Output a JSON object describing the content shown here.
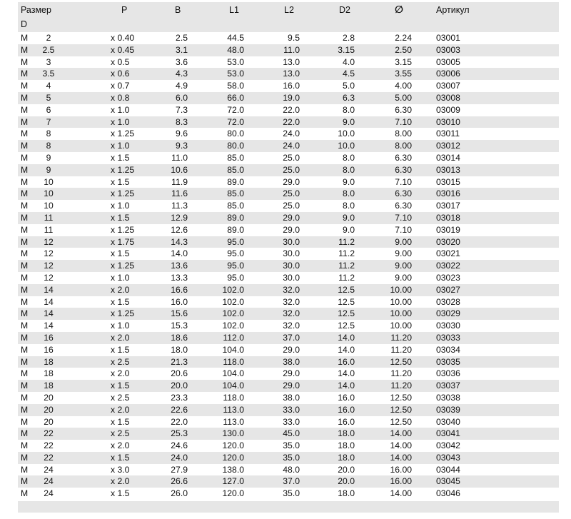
{
  "header": {
    "size": "Размер",
    "d": "D",
    "p": "P",
    "b": "B",
    "l1": "L1",
    "l2": "L2",
    "d2": "D2",
    "dia": "∅",
    "article": "Артикул"
  },
  "rows": [
    {
      "m": "M",
      "d": "2",
      "p": "x 0.40",
      "b": "2.5",
      "l1": "44.5",
      "l2": "9.5",
      "d2": "2.8",
      "dia": "2.24",
      "art": "03001"
    },
    {
      "m": "M",
      "d": "2.5",
      "p": "x 0.45",
      "b": "3.1",
      "l1": "48.0",
      "l2": "11.0",
      "d2": "3.15",
      "dia": "2.50",
      "art": "03003"
    },
    {
      "m": "M",
      "d": "3",
      "p": "x 0.5",
      "b": "3.6",
      "l1": "53.0",
      "l2": "13.0",
      "d2": "4.0",
      "dia": "3.15",
      "art": "03005"
    },
    {
      "m": "M",
      "d": "3.5",
      "p": "x 0.6",
      "b": "4.3",
      "l1": "53.0",
      "l2": "13.0",
      "d2": "4.5",
      "dia": "3.55",
      "art": "03006"
    },
    {
      "m": "M",
      "d": "4",
      "p": "x 0.7",
      "b": "4.9",
      "l1": "58.0",
      "l2": "16.0",
      "d2": "5.0",
      "dia": "4.00",
      "art": "03007"
    },
    {
      "m": "M",
      "d": "5",
      "p": "x 0.8",
      "b": "6.0",
      "l1": "66.0",
      "l2": "19.0",
      "d2": "6.3",
      "dia": "5.00",
      "art": "03008"
    },
    {
      "m": "M",
      "d": "6",
      "p": "x 1.0",
      "b": "7.3",
      "l1": "72.0",
      "l2": "22.0",
      "d2": "8.0",
      "dia": "6.30",
      "art": "03009"
    },
    {
      "m": "M",
      "d": "7",
      "p": "x 1.0",
      "b": "8.3",
      "l1": "72.0",
      "l2": "22.0",
      "d2": "9.0",
      "dia": "7.10",
      "art": "03010"
    },
    {
      "m": "M",
      "d": "8",
      "p": "x 1.25",
      "b": "9.6",
      "l1": "80.0",
      "l2": "24.0",
      "d2": "10.0",
      "dia": "8.00",
      "art": "03011"
    },
    {
      "m": "M",
      "d": "8",
      "p": "x 1.0",
      "b": "9.3",
      "l1": "80.0",
      "l2": "24.0",
      "d2": "10.0",
      "dia": "8.00",
      "art": "03012"
    },
    {
      "m": "M",
      "d": "9",
      "p": "x 1.5",
      "b": "11.0",
      "l1": "85.0",
      "l2": "25.0",
      "d2": "8.0",
      "dia": "6.30",
      "art": "03014"
    },
    {
      "m": "M",
      "d": "9",
      "p": "x 1.25",
      "b": "10.6",
      "l1": "85.0",
      "l2": "25.0",
      "d2": "8.0",
      "dia": "6.30",
      "art": "03013"
    },
    {
      "m": "M",
      "d": "10",
      "p": "x 1.5",
      "b": "11.9",
      "l1": "89.0",
      "l2": "29.0",
      "d2": "9.0",
      "dia": "7.10",
      "art": "03015"
    },
    {
      "m": "M",
      "d": "10",
      "p": "x 1.25",
      "b": "11.6",
      "l1": "85.0",
      "l2": "25.0",
      "d2": "8.0",
      "dia": "6.30",
      "art": "03016"
    },
    {
      "m": "M",
      "d": "10",
      "p": "x 1.0",
      "b": "11.3",
      "l1": "85.0",
      "l2": "25.0",
      "d2": "8.0",
      "dia": "6.30",
      "art": "03017"
    },
    {
      "m": "M",
      "d": "11",
      "p": "x 1.5",
      "b": "12.9",
      "l1": "89.0",
      "l2": "29.0",
      "d2": "9.0",
      "dia": "7.10",
      "art": "03018"
    },
    {
      "m": "M",
      "d": "11",
      "p": "x 1.25",
      "b": "12.6",
      "l1": "89.0",
      "l2": "29.0",
      "d2": "9.0",
      "dia": "7.10",
      "art": "03019"
    },
    {
      "m": "M",
      "d": "12",
      "p": "x 1.75",
      "b": "14.3",
      "l1": "95.0",
      "l2": "30.0",
      "d2": "11.2",
      "dia": "9.00",
      "art": "03020"
    },
    {
      "m": "M",
      "d": "12",
      "p": "x 1.5",
      "b": "14.0",
      "l1": "95.0",
      "l2": "30.0",
      "d2": "11.2",
      "dia": "9.00",
      "art": "03021"
    },
    {
      "m": "M",
      "d": "12",
      "p": "x 1.25",
      "b": "13.6",
      "l1": "95.0",
      "l2": "30.0",
      "d2": "11.2",
      "dia": "9.00",
      "art": "03022"
    },
    {
      "m": "M",
      "d": "12",
      "p": "x 1.0",
      "b": "13.3",
      "l1": "95.0",
      "l2": "30.0",
      "d2": "11.2",
      "dia": "9.00",
      "art": "03023"
    },
    {
      "m": "M",
      "d": "14",
      "p": "x 2.0",
      "b": "16.6",
      "l1": "102.0",
      "l2": "32.0",
      "d2": "12.5",
      "dia": "10.00",
      "art": "03027"
    },
    {
      "m": "M",
      "d": "14",
      "p": "x 1.5",
      "b": "16.0",
      "l1": "102.0",
      "l2": "32.0",
      "d2": "12.5",
      "dia": "10.00",
      "art": "03028"
    },
    {
      "m": "M",
      "d": "14",
      "p": "x 1.25",
      "b": "15.6",
      "l1": "102.0",
      "l2": "32.0",
      "d2": "12.5",
      "dia": "10.00",
      "art": "03029"
    },
    {
      "m": "M",
      "d": "14",
      "p": "x 1.0",
      "b": "15.3",
      "l1": "102.0",
      "l2": "32.0",
      "d2": "12.5",
      "dia": "10.00",
      "art": "03030"
    },
    {
      "m": "M",
      "d": "16",
      "p": "x 2.0",
      "b": "18.6",
      "l1": "112.0",
      "l2": "37.0",
      "d2": "14.0",
      "dia": "11.20",
      "art": "03033"
    },
    {
      "m": "M",
      "d": "16",
      "p": "x 1.5",
      "b": "18.0",
      "l1": "104.0",
      "l2": "29.0",
      "d2": "14.0",
      "dia": "11.20",
      "art": "03034"
    },
    {
      "m": "M",
      "d": "18",
      "p": "x 2.5",
      "b": "21.3",
      "l1": "118.0",
      "l2": "38.0",
      "d2": "16.0",
      "dia": "12.50",
      "art": "03035"
    },
    {
      "m": "M",
      "d": "18",
      "p": "x 2.0",
      "b": "20.6",
      "l1": "104.0",
      "l2": "29.0",
      "d2": "14.0",
      "dia": "11.20",
      "art": "03036"
    },
    {
      "m": "M",
      "d": "18",
      "p": "x 1.5",
      "b": "20.0",
      "l1": "104.0",
      "l2": "29.0",
      "d2": "14.0",
      "dia": "11.20",
      "art": "03037"
    },
    {
      "m": "M",
      "d": "20",
      "p": "x 2.5",
      "b": "23.3",
      "l1": "118.0",
      "l2": "38.0",
      "d2": "16.0",
      "dia": "12.50",
      "art": "03038"
    },
    {
      "m": "M",
      "d": "20",
      "p": "x 2.0",
      "b": "22.6",
      "l1": "113.0",
      "l2": "33.0",
      "d2": "16.0",
      "dia": "12.50",
      "art": "03039"
    },
    {
      "m": "M",
      "d": "20",
      "p": "x 1.5",
      "b": "22.0",
      "l1": "113.0",
      "l2": "33.0",
      "d2": "16.0",
      "dia": "12.50",
      "art": "03040"
    },
    {
      "m": "M",
      "d": "22",
      "p": "x 2.5",
      "b": "25.3",
      "l1": "130.0",
      "l2": "45.0",
      "d2": "18.0",
      "dia": "14.00",
      "art": "03041"
    },
    {
      "m": "M",
      "d": "22",
      "p": "x 2.0",
      "b": "24.6",
      "l1": "120.0",
      "l2": "35.0",
      "d2": "18.0",
      "dia": "14.00",
      "art": "03042"
    },
    {
      "m": "M",
      "d": "22",
      "p": "x 1.5",
      "b": "24.0",
      "l1": "120.0",
      "l2": "35.0",
      "d2": "18.0",
      "dia": "14.00",
      "art": "03043"
    },
    {
      "m": "M",
      "d": "24",
      "p": "x 3.0",
      "b": "27.9",
      "l1": "138.0",
      "l2": "48.0",
      "d2": "20.0",
      "dia": "16.00",
      "art": "03044"
    },
    {
      "m": "M",
      "d": "24",
      "p": "x 2.0",
      "b": "26.6",
      "l1": "127.0",
      "l2": "37.0",
      "d2": "20.0",
      "dia": "16.00",
      "art": "03045"
    },
    {
      "m": "M",
      "d": "24",
      "p": "x 1.5",
      "b": "26.0",
      "l1": "120.0",
      "l2": "35.0",
      "d2": "18.0",
      "dia": "14.00",
      "art": "03046"
    }
  ]
}
